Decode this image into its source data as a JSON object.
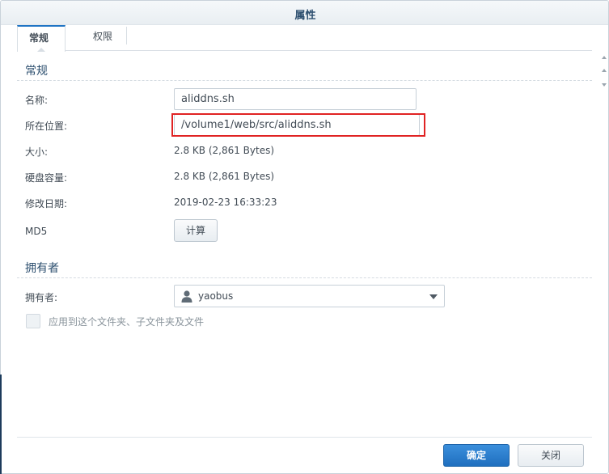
{
  "dialog": {
    "title": "属性"
  },
  "tabs": [
    {
      "label": "常规",
      "active": true
    },
    {
      "label": "权限",
      "active": false
    }
  ],
  "general": {
    "section_title": "常规",
    "name_label": "名称:",
    "name_value": "aliddns.sh",
    "location_label": "所在位置:",
    "location_value": "/volume1/web/src/aliddns.sh",
    "size_label": "大小:",
    "size_value": "2.8 KB (2,861 Bytes)",
    "disk_label": "硬盘容量:",
    "disk_value": "2.8 KB (2,861 Bytes)",
    "modified_label": "修改日期:",
    "modified_value": "2019-02-23 16:33:23",
    "md5_label": "MD5",
    "calc_button": "计算"
  },
  "owner": {
    "section_title": "拥有者",
    "owner_label": "拥有者:",
    "owner_value": "yaobus",
    "apply_checkbox_label": "应用到这个文件夹、子文件夹及文件",
    "apply_checked": false
  },
  "footer": {
    "ok_label": "确定",
    "close_label": "关闭"
  },
  "colors": {
    "accent": "#1f74c4",
    "highlight": "#e02323"
  }
}
